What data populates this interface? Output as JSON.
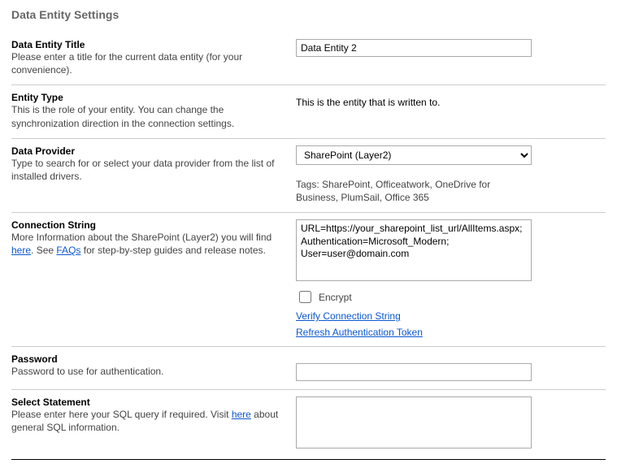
{
  "page": {
    "title": "Data Entity Settings"
  },
  "entity_title": {
    "label": "Data Entity Title",
    "help": "Please enter a title for the current data entity (for your convenience).",
    "value": "Data Entity 2"
  },
  "entity_type": {
    "label": "Entity Type",
    "help": "This is the role of your entity. You can change the synchronization direction in the connection settings.",
    "value": "This is the entity that is written to."
  },
  "data_provider": {
    "label": "Data Provider",
    "help": "Type to search for or select your data provider from the list of installed drivers.",
    "selected": "SharePoint (Layer2)",
    "tags": "Tags: SharePoint, Officeatwork, OneDrive for Business, PlumSail, Office 365"
  },
  "connection_string": {
    "label": "Connection String",
    "help_pre": "More Information about the SharePoint (Layer2) you will find ",
    "help_link1": "here",
    "help_mid": ". See ",
    "help_link2": "FAQs",
    "help_post": " for step-by-step guides and release notes.",
    "value": "URL=https://your_sharepoint_list_url/AllItems.aspx;\nAuthentication=Microsoft_Modern;\nUser=user@domain.com",
    "encrypt_label": "Encrypt",
    "verify_link": "Verify Connection String",
    "refresh_link": "Refresh Authentication Token"
  },
  "password": {
    "label": "Password",
    "help": "Password to use for authentication.",
    "value": ""
  },
  "select_statement": {
    "label": "Select Statement",
    "help_pre": "Please enter here your SQL query if required. Visit ",
    "help_link": "here",
    "help_post": " about general SQL information.",
    "value": ""
  }
}
